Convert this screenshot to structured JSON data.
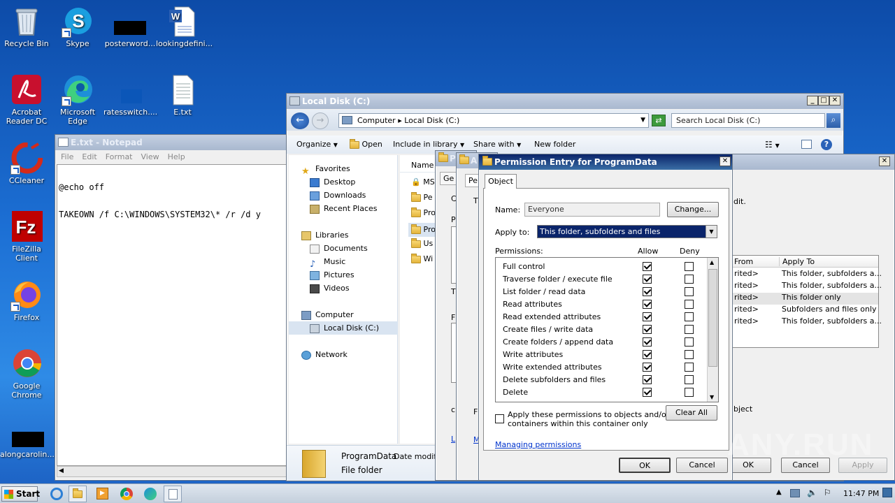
{
  "desktop": {
    "icons": [
      {
        "label": "Recycle Bin"
      },
      {
        "label": "Skype"
      },
      {
        "label": "posterword..."
      },
      {
        "label": "lookingdefini..."
      },
      {
        "label": "Acrobat Reader DC"
      },
      {
        "label": "Microsoft Edge"
      },
      {
        "label": "ratesswitch...."
      },
      {
        "label": "E.txt"
      },
      {
        "label": "CCleaner"
      },
      {
        "label": "FileZilla Client"
      },
      {
        "label": "Firefox"
      },
      {
        "label": "Google Chrome"
      },
      {
        "label": "alongcarolin..."
      }
    ]
  },
  "notepad": {
    "title": "E.txt - Notepad",
    "menu": [
      "File",
      "Edit",
      "Format",
      "View",
      "Help"
    ],
    "lines": [
      "@echo off",
      "TAKEOWN /f C:\\WINDOWS\\SYSTEM32\\* /r /d y"
    ]
  },
  "explorer": {
    "title": "Local Disk (C:)",
    "breadcrumb": [
      "Computer",
      "Local Disk (C:)"
    ],
    "search_placeholder": "Search Local Disk (C:)",
    "toolbar": [
      "Organize",
      "Open",
      "Include in library",
      "Share with",
      "New folder"
    ],
    "nav": {
      "favorites": "Favorites",
      "fav_items": [
        "Desktop",
        "Downloads",
        "Recent Places"
      ],
      "libraries": "Libraries",
      "lib_items": [
        "Documents",
        "Music",
        "Pictures",
        "Videos"
      ],
      "computer": "Computer",
      "drive": "Local Disk (C:)",
      "network": "Network"
    },
    "col_name": "Name",
    "files": [
      "MS",
      "Pe",
      "Pro",
      "Pro",
      "Us",
      "Wi"
    ],
    "details": {
      "name": "ProgramData",
      "type": "File folder",
      "date_label": "Date modifie"
    }
  },
  "props_partial": {
    "tab1": "Ge",
    "tab2": "Pe",
    "title1": "P",
    "title2": "A",
    "left_letters": [
      "T",
      "C",
      "P",
      "T",
      "F",
      "F",
      "c",
      "L",
      "M"
    ]
  },
  "advanced": {
    "edit_text": "dit.",
    "col_from": "From",
    "col_apply": "Apply To",
    "rows": [
      {
        "from": "rited>",
        "apply": "This folder, subfolders a..."
      },
      {
        "from": "rited>",
        "apply": "This folder, subfolders a..."
      },
      {
        "from": "rited>",
        "apply": "This folder only"
      },
      {
        "from": "rited>",
        "apply": "Subfolders and files only"
      },
      {
        "from": "rited>",
        "apply": "This folder, subfolders a..."
      }
    ],
    "object_text": "bject",
    "ok": "OK",
    "cancel": "Cancel",
    "apply": "Apply"
  },
  "perm": {
    "title": "Permission Entry for ProgramData",
    "tab": "Object",
    "name_label": "Name:",
    "name_value": "Everyone",
    "change": "Change...",
    "apply_label": "Apply to:",
    "apply_value": "This folder, subfolders and files",
    "permissions_label": "Permissions:",
    "allow": "Allow",
    "deny": "Deny",
    "items": [
      {
        "label": "Full control",
        "allow": true,
        "deny": false
      },
      {
        "label": "Traverse folder / execute file",
        "allow": true,
        "deny": false
      },
      {
        "label": "List folder / read data",
        "allow": true,
        "deny": false
      },
      {
        "label": "Read attributes",
        "allow": true,
        "deny": false
      },
      {
        "label": "Read extended attributes",
        "allow": true,
        "deny": false
      },
      {
        "label": "Create files / write data",
        "allow": true,
        "deny": false
      },
      {
        "label": "Create folders / append data",
        "allow": true,
        "deny": false
      },
      {
        "label": "Write attributes",
        "allow": true,
        "deny": false
      },
      {
        "label": "Write extended attributes",
        "allow": true,
        "deny": false
      },
      {
        "label": "Delete subfolders and files",
        "allow": true,
        "deny": false
      },
      {
        "label": "Delete",
        "allow": true,
        "deny": false
      }
    ],
    "apply_child_line1": "Apply these permissions to objects and/or",
    "apply_child_line2": "containers within this container only",
    "clear_all": "Clear All",
    "managing": "Managing permissions",
    "ok": "OK",
    "cancel": "Cancel"
  },
  "taskbar": {
    "start": "Start",
    "time": "11:47 PM"
  },
  "watermark": "ANY.RUN",
  "colors": {
    "desktop": "#1c6fd4",
    "title_active": "#0a246a",
    "selection": "#0a246a",
    "link": "#0033cc"
  }
}
